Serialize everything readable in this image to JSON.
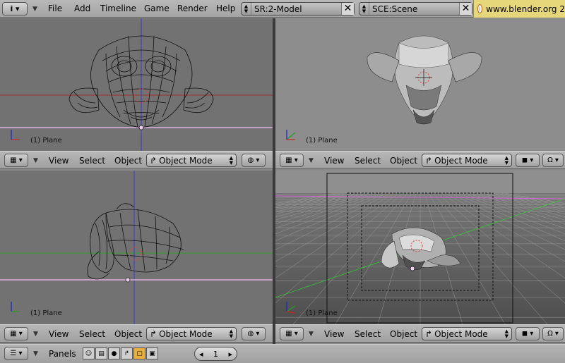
{
  "top": {
    "menus": [
      "File",
      "Add",
      "Timeline",
      "Game",
      "Render",
      "Help"
    ],
    "screen": "SR:2-Model",
    "scene": "SCE:Scene",
    "url": "www.blender.org 2"
  },
  "viewports": {
    "front": {
      "label": "(1) Plane"
    },
    "camera": {
      "label": "(1) Plane"
    },
    "side": {
      "label": "(1) Plane"
    },
    "persp": {
      "label": "(1) Plane"
    }
  },
  "header": {
    "view": "View",
    "select": "Select",
    "object": "Object",
    "mode": "Object Mode"
  },
  "bottom": {
    "panels": "Panels",
    "frame": "1"
  },
  "icons": {
    "info": "info-icon",
    "grid": "grid-view-icon",
    "mode": "object-mode-icon",
    "shading": "shading-icon"
  }
}
